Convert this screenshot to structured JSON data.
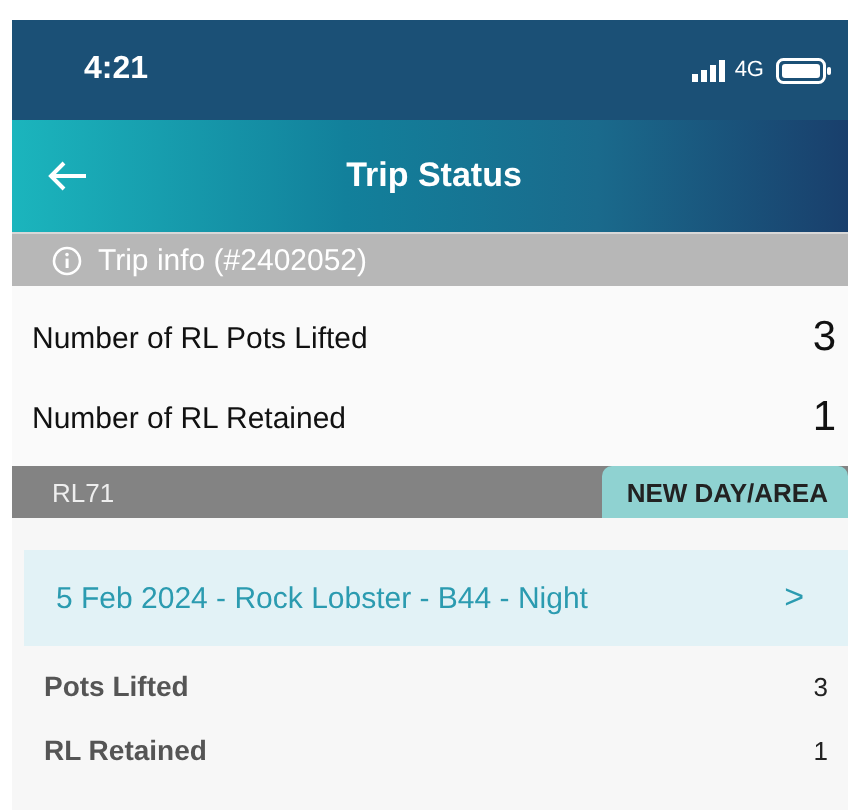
{
  "status_bar": {
    "time": "4:21",
    "network": "4G"
  },
  "header": {
    "title": "Trip Status"
  },
  "info_bar": {
    "text": "Trip info (#2402052)"
  },
  "summary": [
    {
      "label": "Number of RL Pots Lifted",
      "value": "3"
    },
    {
      "label": "Number of RL Retained",
      "value": "1"
    }
  ],
  "section": {
    "label": "RL71",
    "button": "NEW DAY/AREA"
  },
  "trip": {
    "title": "5 Feb 2024 - Rock Lobster - B44 - Night",
    "chevron": ">"
  },
  "details": [
    {
      "label": "Pots Lifted",
      "value": "3"
    },
    {
      "label": "RL Retained",
      "value": "1"
    }
  ]
}
